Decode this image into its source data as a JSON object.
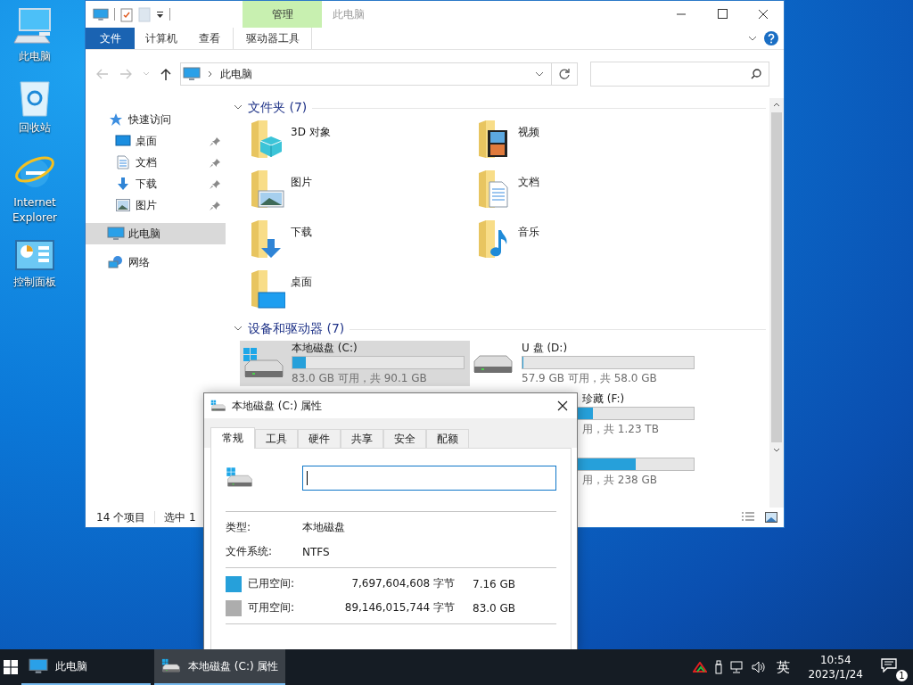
{
  "desktop_icons": [
    {
      "label": "此电脑",
      "kind": "computer"
    },
    {
      "label": "回收站",
      "kind": "recycle"
    },
    {
      "label": "Internet Explorer",
      "kind": "browser"
    },
    {
      "label": "控制面板",
      "kind": "control"
    }
  ],
  "explorer": {
    "title": "此电脑",
    "context_group": "管理",
    "ribbon_tabs": [
      {
        "label": "文件",
        "kind": "file"
      },
      {
        "label": "计算机",
        "kind": "normal"
      },
      {
        "label": "查看",
        "kind": "normal"
      },
      {
        "label": "驱动器工具",
        "kind": "context"
      }
    ],
    "address": "此电脑",
    "nav": [
      {
        "label": "快速访问",
        "kind": "star",
        "selected": false,
        "children": [
          {
            "label": "桌面",
            "kind": "desktop",
            "selected": false,
            "pinned": true
          },
          {
            "label": "文档",
            "kind": "document",
            "selected": false,
            "pinned": true
          },
          {
            "label": "下载",
            "kind": "download",
            "selected": false,
            "pinned": true
          },
          {
            "label": "图片",
            "kind": "picture",
            "selected": false,
            "pinned": true
          }
        ]
      },
      {
        "label": "此电脑",
        "kind": "computer",
        "selected": true
      },
      {
        "label": "网络",
        "kind": "network",
        "selected": false
      }
    ],
    "folders": {
      "title": "文件夹 (7)",
      "expanded": true,
      "items": [
        {
          "label": "3D 对象",
          "kind": "cube"
        },
        {
          "label": "视频",
          "kind": "video"
        },
        {
          "label": "图片",
          "kind": "picture"
        },
        {
          "label": "文档",
          "kind": "document"
        },
        {
          "label": "下载",
          "kind": "download"
        },
        {
          "label": "音乐",
          "kind": "music"
        },
        {
          "label": "桌面",
          "kind": "desktop"
        }
      ]
    },
    "drives": {
      "title": "设备和驱动器 (7)",
      "expanded": true,
      "items": [
        {
          "name": "本地磁盘 (C:)",
          "free": "83.0 GB 可用，共 90.1 GB",
          "level": 0.08,
          "selected": true,
          "kind": "system"
        },
        {
          "name": "U 盘 (D:)",
          "free": "57.9 GB 可用，共 58.0 GB",
          "level": 0.003,
          "selected": false,
          "kind": "removable"
        },
        {
          "name": "珍藏  (F:)",
          "free": "用，共 1.23 TB",
          "level": 0.41,
          "selected": false,
          "kind": "covered"
        },
        {
          "free": "用，共 238 GB",
          "level": 0.66,
          "selected": false,
          "kind": "covered"
        }
      ]
    },
    "status": {
      "count": "14 个项目",
      "selection": "选中 1"
    }
  },
  "dialog": {
    "title": "本地磁盘 (C:) 属性",
    "tabs": [
      {
        "label": "常规",
        "selected": true
      },
      {
        "label": "工具",
        "selected": false
      },
      {
        "label": "硬件",
        "selected": false
      },
      {
        "label": "共享",
        "selected": false
      },
      {
        "label": "安全",
        "selected": false
      },
      {
        "label": "配额",
        "selected": false
      }
    ],
    "properties": [
      {
        "label": "类型:",
        "value": "本地磁盘"
      },
      {
        "label": "文件系统:",
        "value": "NTFS"
      }
    ],
    "space": [
      {
        "label": "已用空间:",
        "bytes": "7,697,604,608 字节",
        "size": "7.16 GB",
        "color": "#26a0da"
      },
      {
        "label": "可用空间:",
        "bytes": "89,146,015,744 字节",
        "size": "83.0 GB",
        "color": "#adadad"
      }
    ]
  },
  "taskbar": {
    "apps": [
      {
        "label": "此电脑",
        "kind": "computer",
        "selected": false
      },
      {
        "label": "本地磁盘 (C:) 属性",
        "kind": "drive",
        "selected": true
      }
    ],
    "ime": "英",
    "time": "10:54",
    "date": "2023/1/24",
    "notifications": "1"
  }
}
